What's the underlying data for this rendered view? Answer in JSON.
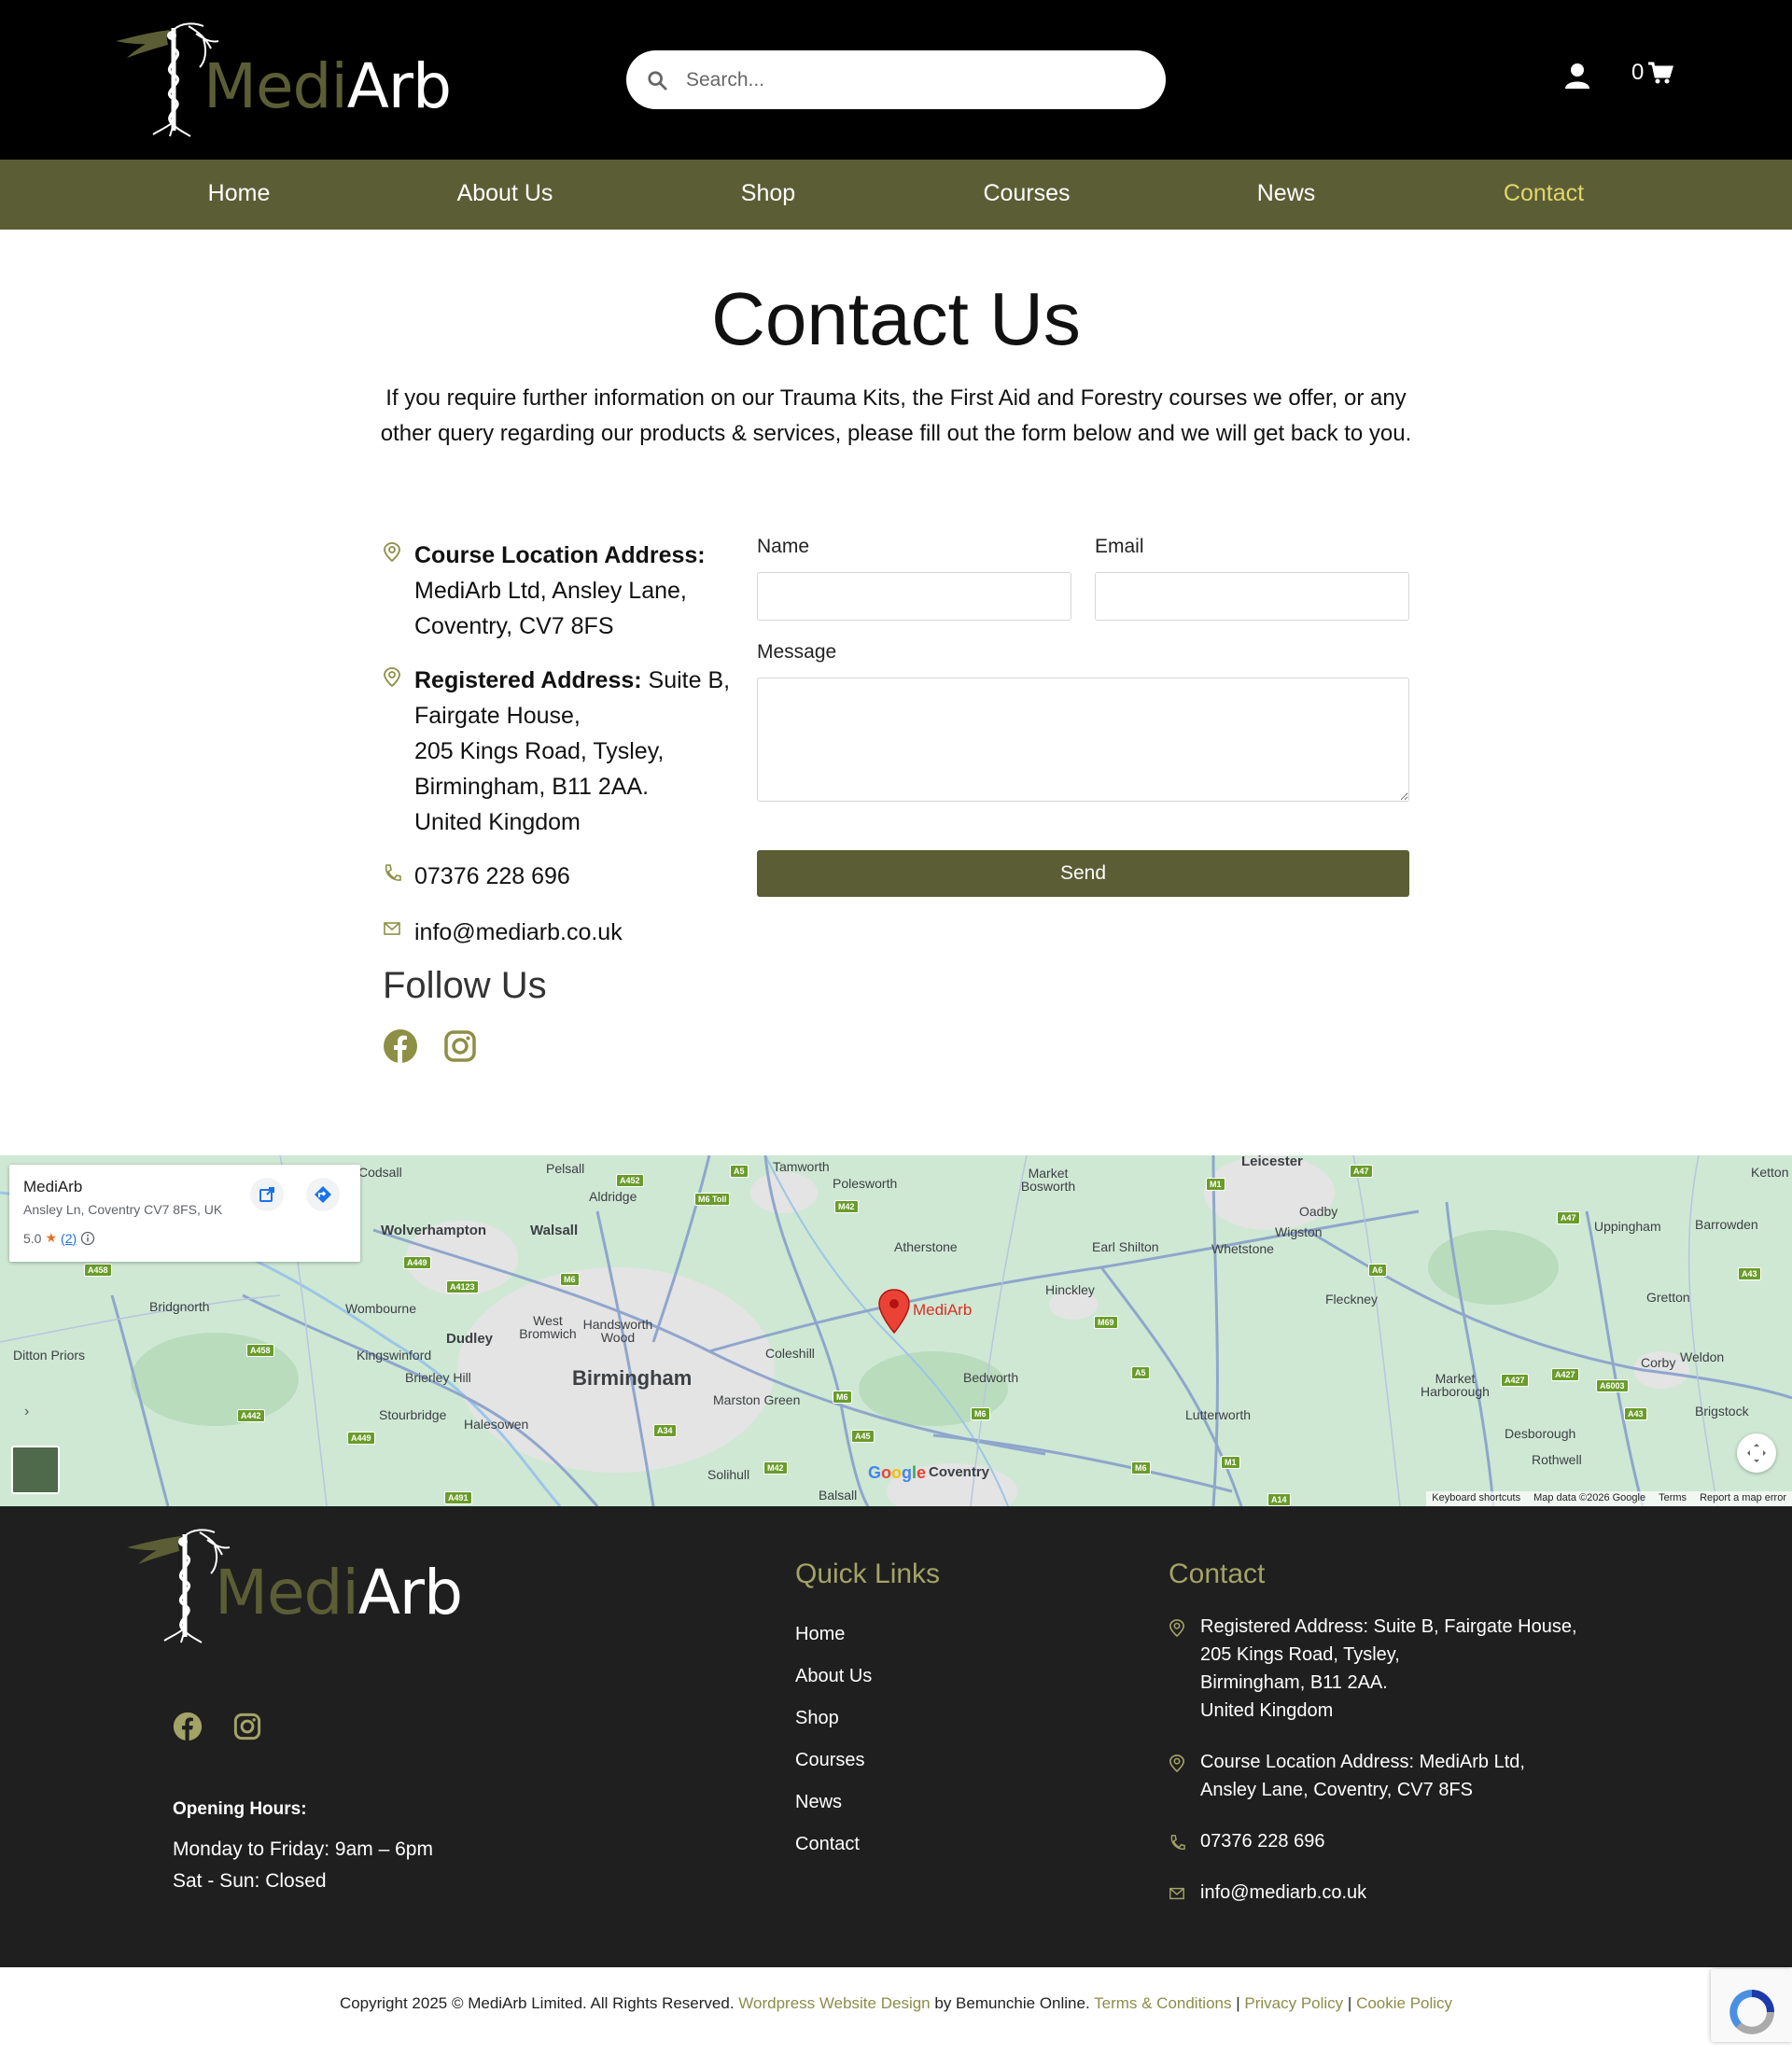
{
  "header": {
    "logo": {
      "medi": "Medi",
      "arb": "Arb"
    },
    "search": {
      "placeholder": "Search..."
    },
    "cart_count": "0"
  },
  "nav": {
    "items": [
      {
        "label": "Home"
      },
      {
        "label": "About Us"
      },
      {
        "label": "Shop"
      },
      {
        "label": "Courses"
      },
      {
        "label": "News"
      },
      {
        "label": "Contact",
        "active": true
      }
    ]
  },
  "main": {
    "title": "Contact Us",
    "intro": "If you require further information on our Trauma Kits, the First Aid and Forestry courses we offer, or any other query regarding our products & services, please fill out the form below and we will get back to you.",
    "course_location": {
      "label": "Course Location Address:",
      "lines": [
        "MediArb Ltd, Ansley Lane,",
        "Coventry, CV7 8FS"
      ]
    },
    "registered": {
      "label": "Registered Address:",
      "first": " Suite B,",
      "lines": [
        "Fairgate House,",
        "205 Kings Road, Tysley,",
        "Birmingham, B11 2AA.",
        "United Kingdom"
      ]
    },
    "phone": "07376 228 696",
    "email": "info@mediarb.co.uk",
    "follow_title": "Follow Us",
    "form": {
      "name_label": "Name",
      "email_label": "Email",
      "message_label": "Message",
      "send_label": "Send"
    }
  },
  "map": {
    "place": {
      "name": "MediArb",
      "address": "Ansley Ln, Coventry CV7 8FS, UK",
      "rating": "5.0",
      "star": "★",
      "count": "(2)"
    },
    "pin_label": "MediArb",
    "labels": {
      "birmingham": "Birmingham",
      "coventry": "Coventry",
      "leicester": "Leicester",
      "wolverhampton": "Wolverhampton",
      "walsall": "Walsall",
      "tamworth": "Tamworth",
      "polesworth": "Polesworth",
      "atherstone": "Atherstone",
      "market_bosworth": "Market Bosworth",
      "earl_shilton": "Earl Shilton",
      "hinckley": "Hinckley",
      "nuneaton": "Bedworth",
      "coleshill": "Coleshill",
      "marston_green": "Marston Green",
      "solihull": "Solihull",
      "balsall": "Balsall",
      "dudley": "Dudley",
      "west_bromwich": "West Bromwich",
      "handsworth": "Handsworth Wood",
      "kingswinford": "Kingswinford",
      "brierley_hill": "Brierley Hill",
      "stourbridge": "Stourbridge",
      "halesowen": "Halesowen",
      "wombourne": "Wombourne",
      "bridgnorth": "Bridgnorth",
      "ditton_priors": "Ditton Priors",
      "pelsall": "Pelsall",
      "aldridge": "Aldridge",
      "codsall": "Codsall",
      "whetstone": "Whetstone",
      "wigston": "Wigston",
      "oadby": "Oadby",
      "fleckney": "Fleckney",
      "lutterworth": "Lutterworth",
      "market_harborough": "Market Harborough",
      "desborough": "Desborough",
      "rothwell": "Rothwell",
      "corby": "Corby",
      "gretton": "Gretton",
      "uppingham": "Uppingham",
      "barrowden": "Barrowden",
      "ketton": "Ketton",
      "weldon": "Weldon",
      "brigstock": "Brigstock"
    },
    "footer": {
      "shortcuts": "Keyboard shortcuts",
      "data": "Map data ©2026 Google",
      "terms": "Terms",
      "report": "Report a map error"
    },
    "google": [
      "G",
      "o",
      "o",
      "g",
      "l",
      "e"
    ]
  },
  "footer": {
    "quick_links_title": "Quick Links",
    "quick_links": [
      "Home",
      "About Us",
      "Shop",
      "Courses",
      "News",
      "Contact"
    ],
    "contact_title": "Contact",
    "registered_lines": [
      "Registered Address: Suite B, Fairgate House,",
      "205 Kings Road, Tysley,",
      "Birmingham, B11 2AA.",
      "United Kingdom"
    ],
    "course_lines": [
      "Course Location Address: MediArb Ltd,",
      "Ansley Lane, Coventry, CV7 8FS"
    ],
    "phone": "07376 228 696",
    "email": "info@mediarb.co.uk",
    "hours_title": "Opening Hours:",
    "hours": [
      "Monday to Friday: 9am – 6pm",
      "Sat - Sun: Closed"
    ]
  },
  "copyright": {
    "text1": "Copyright 2025 © MediArb Limited. All Rights Reserved. ",
    "link1": "Wordpress Website Design",
    "text2": " by Bemunchie Online. ",
    "link2": "Terms & Conditions",
    "sep1": " | ",
    "link3": "Privacy Policy",
    "sep2": " | ",
    "link4": "Cookie Policy"
  },
  "colors": {
    "brand_olive": "#5b5e35",
    "nav_active": "#e3d66b",
    "footer_bg": "#1f1f1f",
    "accent_icon": "#a3a368"
  }
}
